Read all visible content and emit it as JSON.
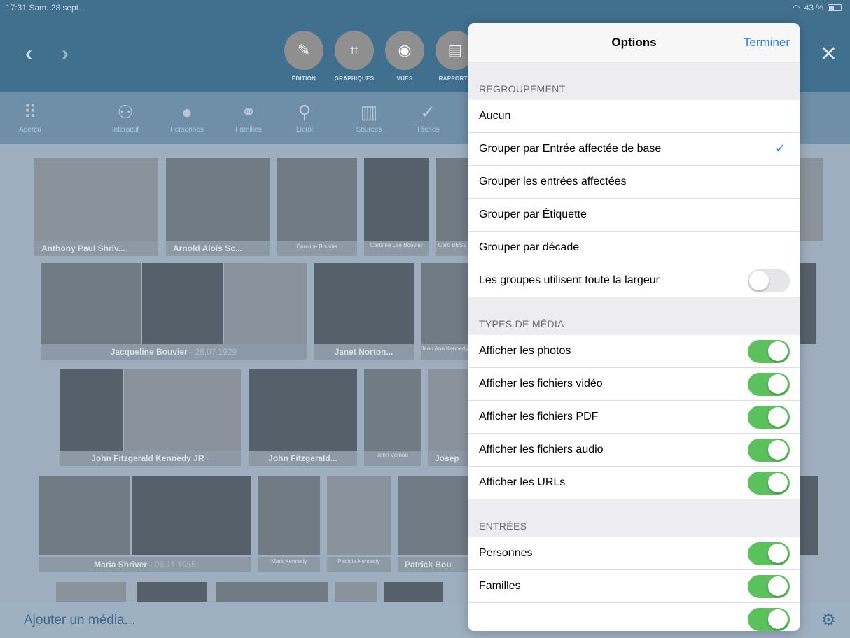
{
  "status": {
    "time": "17:31  Sam. 28 sept.",
    "battery": "43 %"
  },
  "topbar": {
    "modes": [
      {
        "label": "ÉDITION",
        "icon": "✎"
      },
      {
        "label": "GRAPHIQUES",
        "icon": "⌗"
      },
      {
        "label": "VUES",
        "icon": "◉"
      },
      {
        "label": "RAPPORTS",
        "icon": "▤"
      }
    ]
  },
  "toolbar": {
    "items": [
      {
        "label": "Aperçu",
        "icon": "⠿"
      },
      {
        "label": "Interactif",
        "icon": "⚇"
      },
      {
        "label": "Personnes",
        "icon": "●"
      },
      {
        "label": "Familles",
        "icon": "⚭"
      },
      {
        "label": "Lieux",
        "icon": "⚲"
      },
      {
        "label": "Sources",
        "icon": "▥"
      },
      {
        "label": "Tâches",
        "icon": "✓"
      }
    ]
  },
  "gallery": {
    "captions": [
      {
        "name": "Anthony Paul Shriv...",
        "date": ""
      },
      {
        "name": "Arnold Alois Sc...",
        "date": ""
      },
      {
        "name": "Caroline Bouvier",
        "date": ""
      },
      {
        "name": "Caroline Lee Bouvier",
        "date": ""
      },
      {
        "name": "Caro BESS",
        "date": ""
      },
      {
        "name": "Jacqueline Bouvier",
        "date": " - 28.07.1929"
      },
      {
        "name": "Janet Norton...",
        "date": ""
      },
      {
        "name": "Jean Ann Kennedy",
        "date": ""
      },
      {
        "name": "John Fitzgerald Kennedy JR",
        "date": " -"
      },
      {
        "name": "John Fitzgerald...",
        "date": ""
      },
      {
        "name": "John Vernou",
        "date": ""
      },
      {
        "name": "Josep",
        "date": ""
      },
      {
        "name": "Maria Shriver",
        "date": " - 06.11.1955"
      },
      {
        "name": "Mark Kennedy",
        "date": ""
      },
      {
        "name": "Patricia Kennedy",
        "date": ""
      },
      {
        "name": "Patrick Bou",
        "date": ""
      }
    ]
  },
  "bottombar": {
    "add_label": "Ajouter un média..."
  },
  "panel": {
    "title": "Options",
    "done": "Terminer",
    "grouping": {
      "header": "REGROUPEMENT",
      "rows": [
        {
          "label": "Aucun"
        },
        {
          "label": "Grouper par Entrée affectée de base",
          "checked": "✓"
        },
        {
          "label": "Grouper les entrées affectées"
        },
        {
          "label": "Grouper par Étiquette"
        },
        {
          "label": "Grouper par décade"
        }
      ],
      "full_width": {
        "label": "Les groupes utilisent toute la largeur",
        "on": false
      }
    },
    "media_types": {
      "header": "TYPES DE MÉDIA",
      "rows": [
        {
          "label": "Afficher les photos",
          "on": true
        },
        {
          "label": "Afficher les fichiers vidéo",
          "on": true
        },
        {
          "label": "Afficher les fichiers PDF",
          "on": true
        },
        {
          "label": "Afficher les fichiers audio",
          "on": true
        },
        {
          "label": "Afficher les URLs",
          "on": true
        }
      ]
    },
    "entries": {
      "header": "ENTRÉES",
      "rows": [
        {
          "label": "Personnes",
          "on": true
        },
        {
          "label": "Familles",
          "on": true
        }
      ]
    }
  },
  "colors": {
    "accent": "#2f7bf0",
    "toggle_on": "#5bc15d",
    "header_bg": "#41708f"
  }
}
